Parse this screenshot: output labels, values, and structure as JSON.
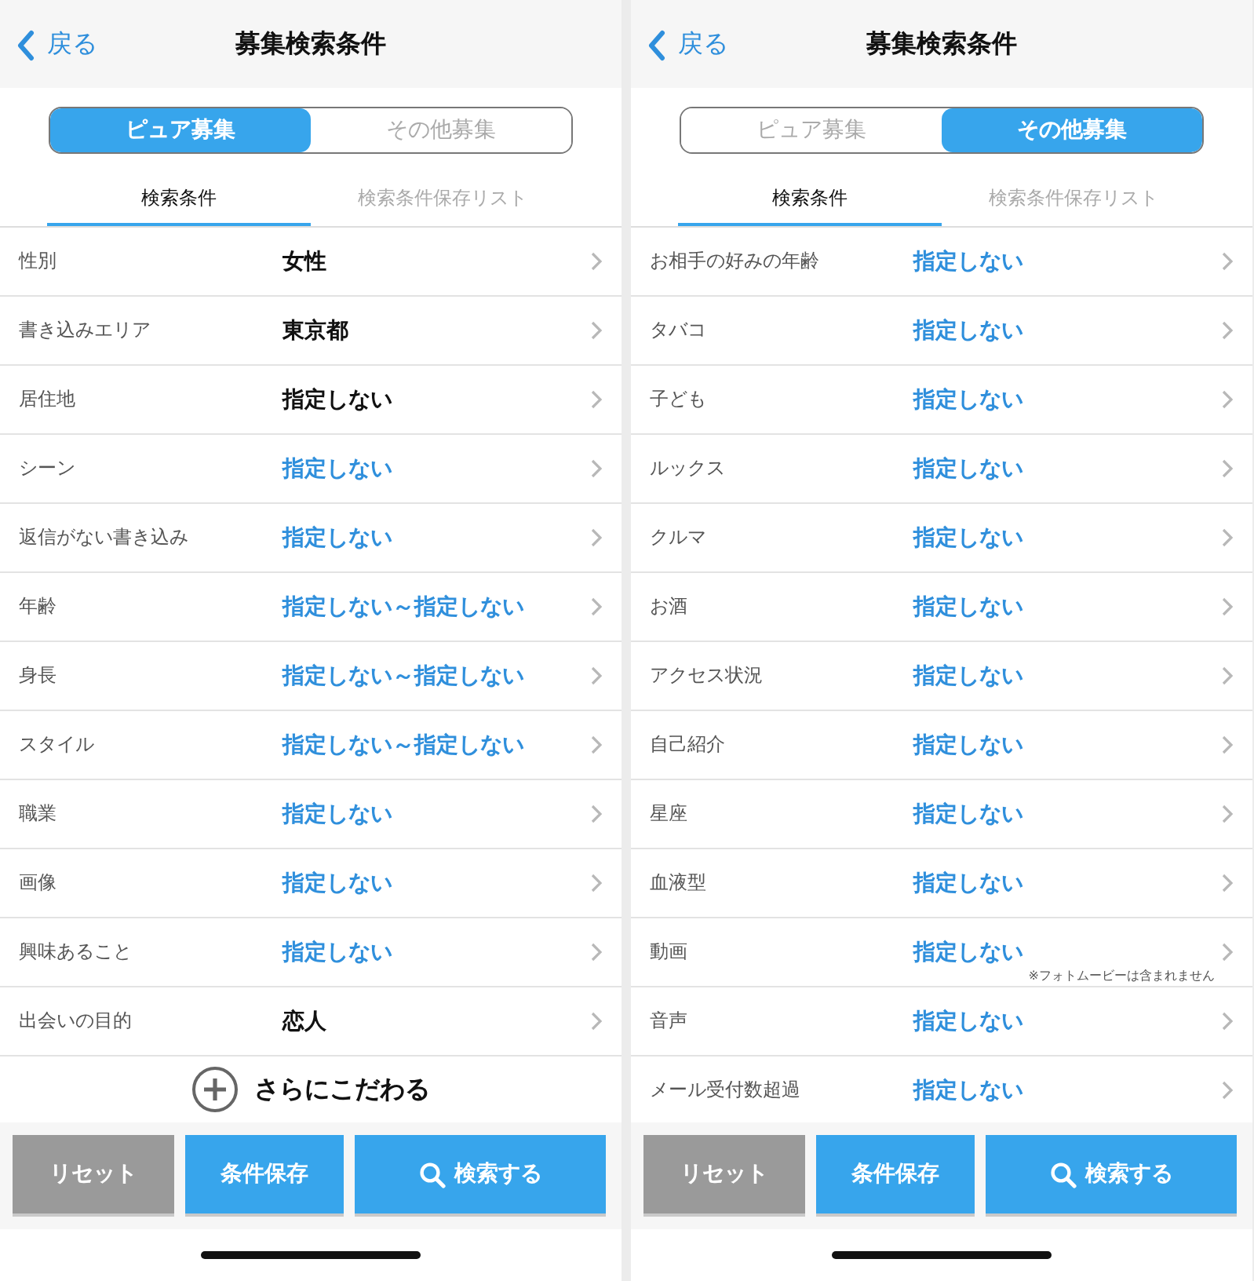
{
  "screens": [
    {
      "back": "戻る",
      "title": "募集検索条件",
      "segments": [
        {
          "label": "ピュア募集",
          "selected": true
        },
        {
          "label": "その他募集",
          "selected": false
        }
      ],
      "subtabs": [
        {
          "label": "検索条件",
          "selected": true
        },
        {
          "label": "検索条件保存リスト",
          "selected": false
        }
      ],
      "rows": [
        {
          "label": "性別",
          "value": "女性",
          "kind": "set"
        },
        {
          "label": "書き込みエリア",
          "value": "東京都",
          "kind": "set"
        },
        {
          "label": "居住地",
          "value": "指定しない",
          "kind": "set"
        },
        {
          "label": "シーン",
          "value": "指定しない",
          "kind": "unset"
        },
        {
          "label": "返信がない書き込み",
          "value": "指定しない",
          "kind": "unset"
        },
        {
          "label": "年齢",
          "value": "指定しない～指定しない",
          "kind": "unset"
        },
        {
          "label": "身長",
          "value": "指定しない～指定しない",
          "kind": "unset"
        },
        {
          "label": "スタイル",
          "value": "指定しない～指定しない",
          "kind": "unset"
        },
        {
          "label": "職業",
          "value": "指定しない",
          "kind": "unset"
        },
        {
          "label": "画像",
          "value": "指定しない",
          "kind": "unset"
        },
        {
          "label": "興味あること",
          "value": "指定しない",
          "kind": "unset"
        },
        {
          "label": "出会いの目的",
          "value": "恋人",
          "kind": "set"
        }
      ],
      "more": "さらにこだわる",
      "buttons": {
        "reset": "リセット",
        "save": "条件保存",
        "search": "検索する"
      }
    },
    {
      "back": "戻る",
      "title": "募集検索条件",
      "segments": [
        {
          "label": "ピュア募集",
          "selected": false
        },
        {
          "label": "その他募集",
          "selected": true
        }
      ],
      "subtabs": [
        {
          "label": "検索条件",
          "selected": true
        },
        {
          "label": "検索条件保存リスト",
          "selected": false
        }
      ],
      "rows": [
        {
          "label": "お相手の好みの年齢",
          "value": "指定しない",
          "kind": "unset"
        },
        {
          "label": "タバコ",
          "value": "指定しない",
          "kind": "unset"
        },
        {
          "label": "子ども",
          "value": "指定しない",
          "kind": "unset"
        },
        {
          "label": "ルックス",
          "value": "指定しない",
          "kind": "unset"
        },
        {
          "label": "クルマ",
          "value": "指定しない",
          "kind": "unset"
        },
        {
          "label": "お酒",
          "value": "指定しない",
          "kind": "unset"
        },
        {
          "label": "アクセス状況",
          "value": "指定しない",
          "kind": "unset"
        },
        {
          "label": "自己紹介",
          "value": "指定しない",
          "kind": "unset"
        },
        {
          "label": "星座",
          "value": "指定しない",
          "kind": "unset"
        },
        {
          "label": "血液型",
          "value": "指定しない",
          "kind": "unset"
        },
        {
          "label": "動画",
          "value": "指定しない",
          "kind": "unset",
          "note": "※フォトムービーは含まれません"
        },
        {
          "label": "音声",
          "value": "指定しない",
          "kind": "unset"
        },
        {
          "label": "メール受付数超過",
          "value": "指定しない",
          "kind": "unset"
        }
      ],
      "buttons": {
        "reset": "リセット",
        "save": "条件保存",
        "search": "検索する"
      }
    }
  ]
}
